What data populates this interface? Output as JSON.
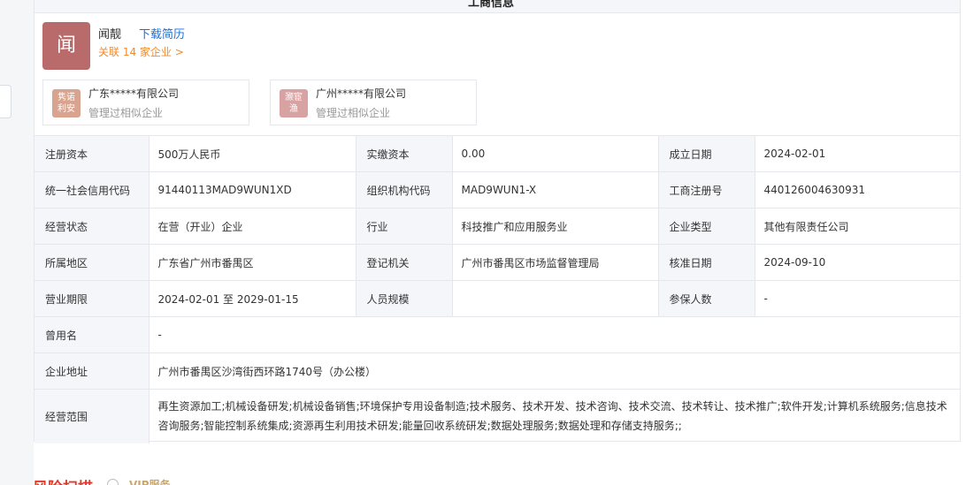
{
  "header": {
    "title": "工商信息"
  },
  "person": {
    "avatar_char": "闻",
    "name": "闻靓",
    "download_label": "下载简历",
    "related_label": "关联 14 家企业 >"
  },
  "companies": [
    {
      "logo_text": "隽诺\n利安",
      "name": "广东*****有限公司",
      "sub": "管理过相似企业"
    },
    {
      "logo_text": "灏宦\n渔",
      "name": "广州*****有限公司",
      "sub": "管理过相似企业"
    }
  ],
  "table": {
    "reg_capital_label": "注册资本",
    "reg_capital": "500万人民币",
    "paid_capital_label": "实缴资本",
    "paid_capital": "0.00",
    "established_label": "成立日期",
    "established": "2024-02-01",
    "credit_code_label": "统一社会信用代码",
    "credit_code": "91440113MAD9WUN1XD",
    "org_code_label": "组织机构代码",
    "org_code": "MAD9WUN1-X",
    "reg_no_label": "工商注册号",
    "reg_no": "440126004630931",
    "status_label": "经营状态",
    "status": "在营（开业）企业",
    "industry_label": "行业",
    "industry": "科技推广和应用服务业",
    "type_label": "企业类型",
    "type": "其他有限责任公司",
    "region_label": "所属地区",
    "region": "广东省广州市番禺区",
    "authority_label": "登记机关",
    "authority": "广州市番禺区市场监督管理局",
    "approval_label": "核准日期",
    "approval": "2024-09-10",
    "term_label": "营业期限",
    "term": "2024-02-01 至 2029-01-15",
    "staff_label": "人员规模",
    "staff": "",
    "insured_label": "参保人数",
    "insured": "-",
    "former_name_label": "曾用名",
    "former_name": "-",
    "address_label": "企业地址",
    "address": "广州市番禺区沙湾街西环路1740号（办公楼）",
    "scope_label": "经营范围",
    "scope": "再生资源加工;机械设备研发;机械设备销售;环境保护专用设备制造;技术服务、技术开发、技术咨询、技术交流、技术转让、技术推广;软件开发;计算机系统服务;信息技术咨询服务;智能控制系统集成;资源再生利用技术研发;能量回收系统研发;数据处理服务;数据处理和存储支持服务;;"
  },
  "risk": {
    "title": "风险扫描",
    "vip": "VIP服务"
  },
  "colors": {
    "accent_blue": "#1f6fd6",
    "accent_orange": "#f08a2c",
    "risk_red": "#e23a2a",
    "avatar_bg": "#b86b6a"
  }
}
